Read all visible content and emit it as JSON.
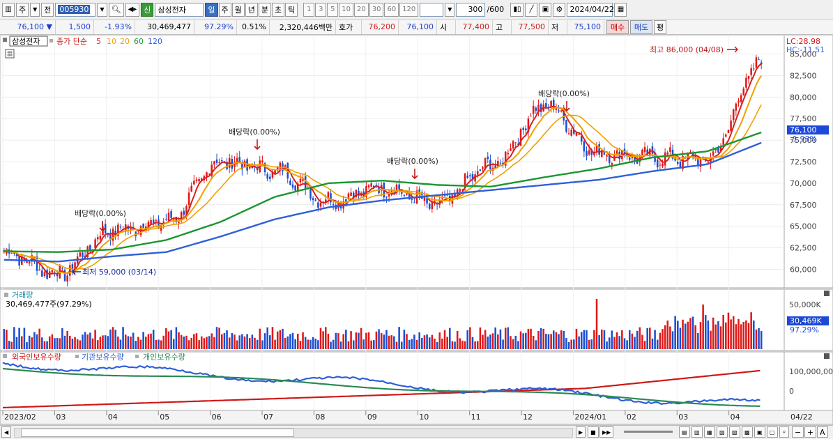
{
  "toolbar": {
    "stock_code": "005930",
    "credit_badge": "신",
    "stock_name": "삼성전자",
    "periods": [
      "일",
      "주",
      "월",
      "년",
      "분",
      "초",
      "틱"
    ],
    "selected_period": "일",
    "intervals": [
      "1",
      "3",
      "5",
      "10",
      "20",
      "30",
      "60",
      "120"
    ],
    "count": "300",
    "count_max": "/600",
    "date": "2024/04/22",
    "mode_a": "주",
    "mode_b": "전"
  },
  "quote": {
    "price": "76,100",
    "change": "1,500",
    "change_pct": "-1.93%",
    "volume": "30,469,477",
    "vol_ratio": "97.29%",
    "turnover_pct": "0.51%",
    "amount": "2,320,446백만",
    "ask_label": "호가",
    "ask": "76,200",
    "bid": "76,100",
    "open_label": "시",
    "open": "77,400",
    "high_label": "고",
    "high": "77,500",
    "low_label": "저",
    "low": "75,100",
    "buy_btn": "매수",
    "sell_btn": "매도",
    "eval_btn": "평"
  },
  "price_panel": {
    "title": "삼성전자",
    "ma_label": "종가 단순",
    "ma_periods": [
      "5",
      "10",
      "20",
      "60",
      "120"
    ],
    "ma_colors": [
      "#d92020",
      "#f0a000",
      "#f0a000",
      "#1a9630",
      "#2f5fd8"
    ],
    "lc": "LC:28.98",
    "hc": "HC:-11.51",
    "y_ticks": [
      "85,000",
      "82,500",
      "80,000",
      "77,500",
      "75,000",
      "72,500",
      "70,000",
      "67,500",
      "65,000",
      "62,500",
      "60,000"
    ],
    "cur_price": "76,100",
    "cur_change": "-1.93%",
    "high_note": "최고 86,000 (04/08)",
    "low_note": "최저 59,000 (03/14)",
    "dividend_note": "배당락(0.00%)"
  },
  "volume_panel": {
    "title": "거래량",
    "value": "30,469,477주(97.29%)",
    "y_tick": "50,000K",
    "cur": "30,469K",
    "cur_pct": "97.29%"
  },
  "holdings_panel": {
    "series": [
      "외국인보유수량",
      "기관보유수량",
      "개인보유수량"
    ],
    "colors": [
      "#d01818",
      "#2f5fd8",
      "#2a8a55"
    ],
    "y_ticks": [
      "100,000,00",
      "0"
    ]
  },
  "x_labels": [
    "2023/02",
    "03",
    "04",
    "05",
    "06",
    "07",
    "08",
    "09",
    "10",
    "11",
    "12",
    "2024/01",
    "02",
    "03",
    "04",
    "04/22"
  ],
  "chart_data": {
    "type": "line",
    "title": "삼성전자",
    "x": [
      "2023/02",
      "03",
      "04",
      "05",
      "06",
      "07",
      "08",
      "09",
      "10",
      "11",
      "12",
      "2024/01",
      "02",
      "03",
      "04"
    ],
    "series": [
      {
        "name": "삼성전자",
        "values": [
          62000,
          59500,
          64500,
          65500,
          72500,
          71500,
          68000,
          69500,
          67500,
          72000,
          79000,
          73500,
          73000,
          72800,
          84000
        ]
      },
      {
        "name": "60",
        "values": [
          62100,
          62000,
          62300,
          63400,
          65500,
          68400,
          70000,
          70300,
          69800,
          69600,
          70700,
          71700,
          73000,
          73700,
          75900
        ]
      },
      {
        "name": "120",
        "values": [
          61100,
          60900,
          61500,
          62000,
          63800,
          65800,
          67200,
          68000,
          68600,
          69200,
          69800,
          70400,
          71400,
          72200,
          74700
        ]
      }
    ],
    "ylim": [
      58500,
      86500
    ],
    "annotations": [
      "최고 86,000 (04/08)",
      "최저 59,000 (03/14)",
      "배당락(0.00%)"
    ],
    "volume": {
      "last": "30,469,477주(97.29%)",
      "tick": "50,000K"
    }
  }
}
